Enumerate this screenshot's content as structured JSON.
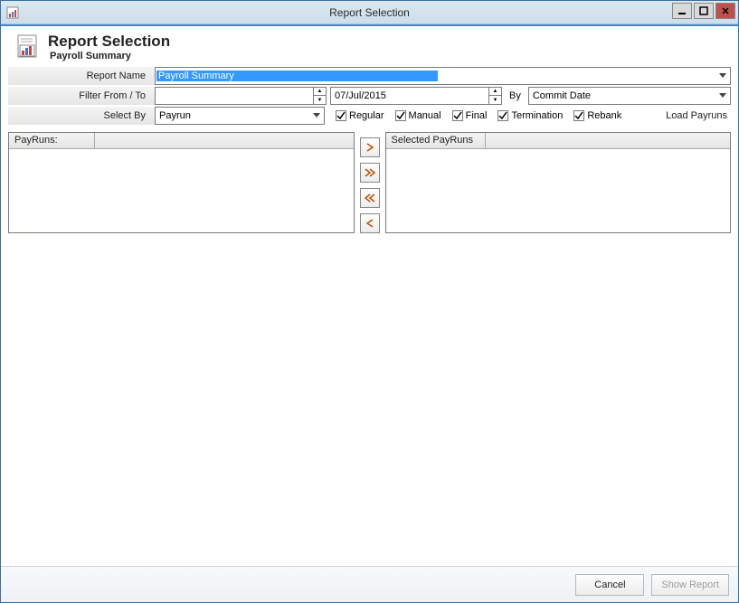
{
  "window": {
    "title": "Report Selection"
  },
  "header": {
    "title": "Report Selection",
    "subtitle": "Payroll Summary"
  },
  "form": {
    "report_name_label": "Report Name",
    "report_name_value": "Payroll Summary",
    "filter_label": "Filter From / To",
    "filter_from_value": "",
    "filter_to_value": "07/Jul/2015",
    "by_label": "By",
    "by_value": "Commit Date",
    "select_by_label": "Select By",
    "select_by_value": "Payrun",
    "checkboxes": {
      "regular": {
        "label": "Regular",
        "checked": true
      },
      "manual": {
        "label": "Manual",
        "checked": true
      },
      "final": {
        "label": "Final",
        "checked": true
      },
      "termination": {
        "label": "Termination",
        "checked": true
      },
      "rebank": {
        "label": "Rebank",
        "checked": true
      }
    },
    "load_payruns_label": "Load Payruns"
  },
  "lists": {
    "left_header": "PayRuns:",
    "right_header": "Selected PayRuns"
  },
  "footer": {
    "cancel_label": "Cancel",
    "show_report_label": "Show Report"
  }
}
